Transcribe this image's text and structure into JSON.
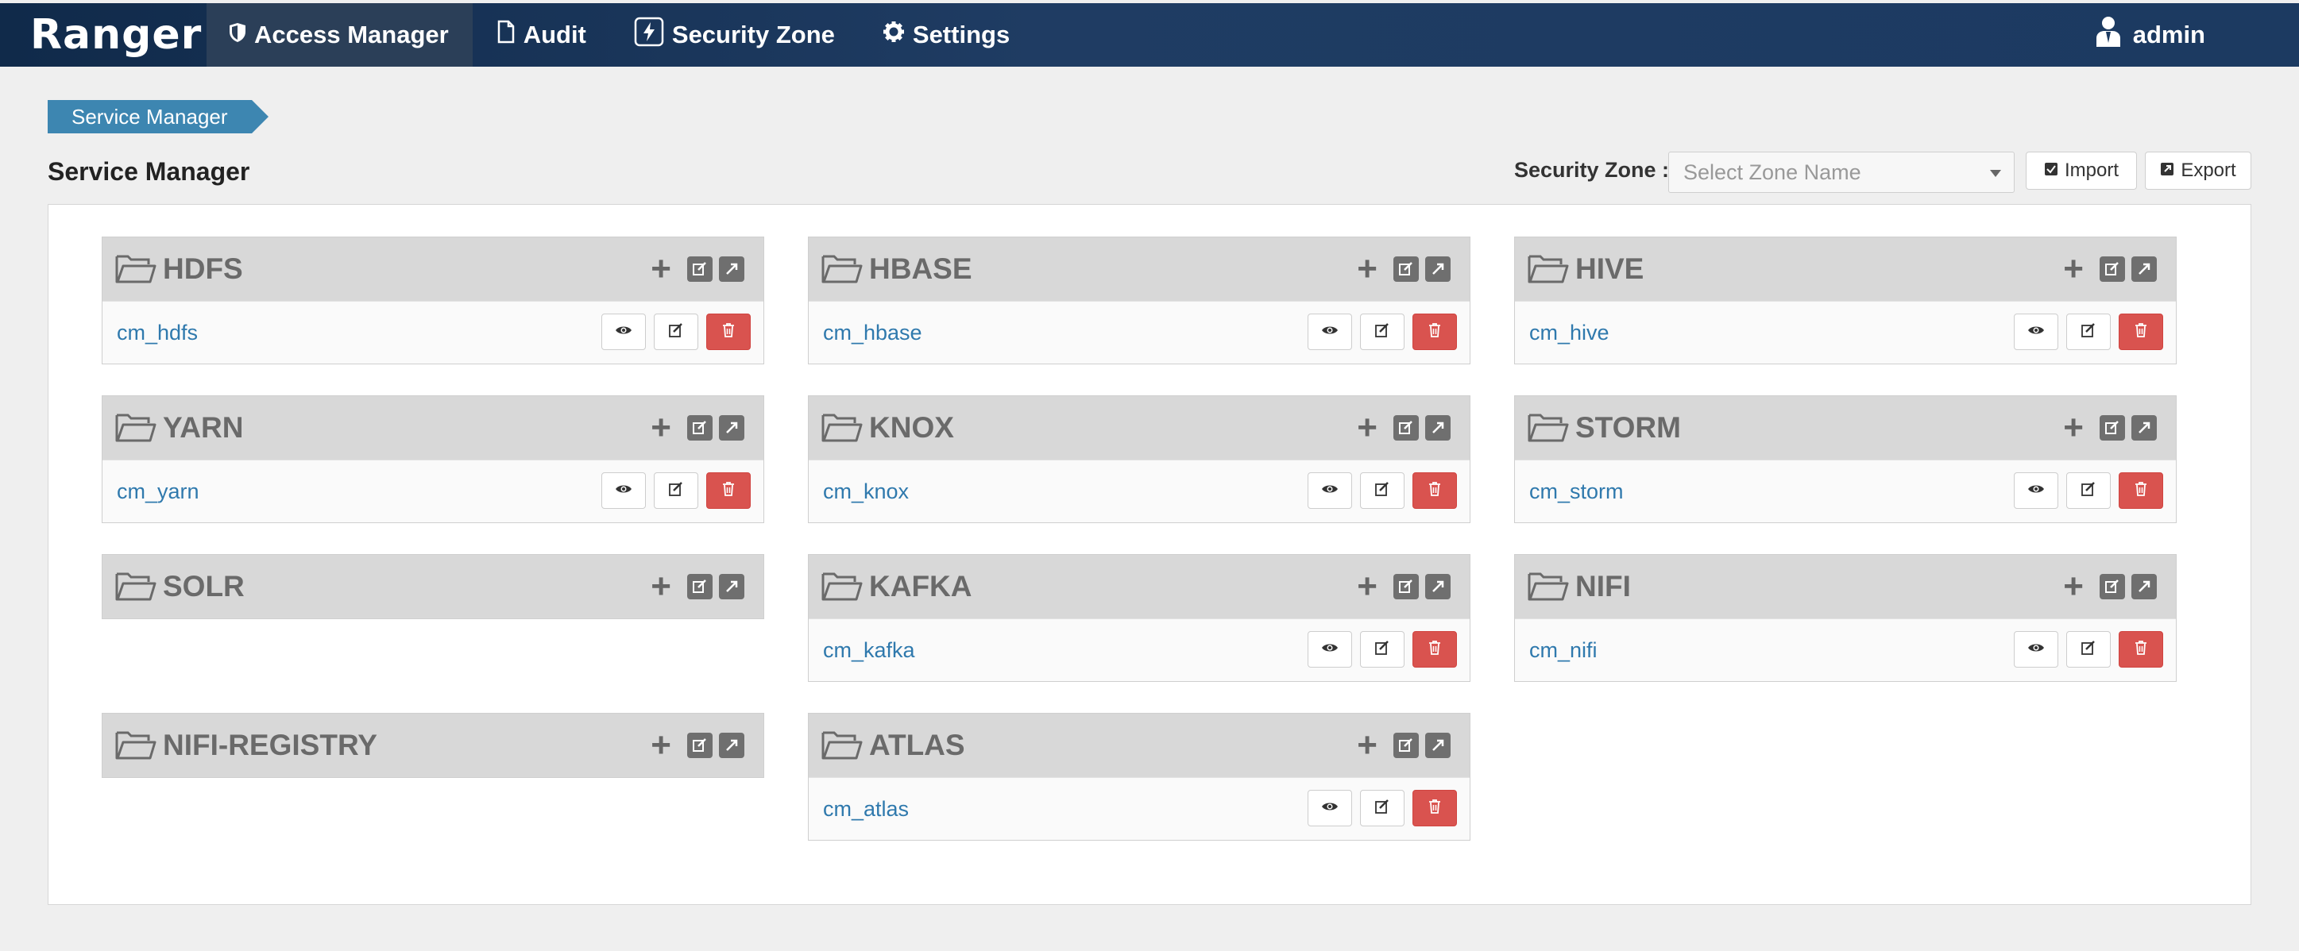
{
  "nav": {
    "brand": "Ranger",
    "items": [
      {
        "label": "Access Manager",
        "icon": "shield-icon"
      },
      {
        "label": "Audit",
        "icon": "file-icon"
      },
      {
        "label": "Security Zone",
        "icon": "lightning-icon"
      },
      {
        "label": "Settings",
        "icon": "gear-icon"
      }
    ],
    "user": "admin"
  },
  "breadcrumb": "Service Manager",
  "page_title": "Service Manager",
  "security_zone": {
    "label": "Security Zone :",
    "placeholder": "Select Zone Name"
  },
  "buttons": {
    "import": "Import",
    "export": "Export"
  },
  "colors": {
    "link": "#2f79ad",
    "delete": "#d9534f",
    "breadcrumb": "#3d86b1",
    "nav": "#1f3c63"
  },
  "services": [
    {
      "name": "HDFS",
      "instances": [
        "cm_hdfs"
      ]
    },
    {
      "name": "HBASE",
      "instances": [
        "cm_hbase"
      ]
    },
    {
      "name": "HIVE",
      "instances": [
        "cm_hive"
      ]
    },
    {
      "name": "YARN",
      "instances": [
        "cm_yarn"
      ]
    },
    {
      "name": "KNOX",
      "instances": [
        "cm_knox"
      ]
    },
    {
      "name": "STORM",
      "instances": [
        "cm_storm"
      ]
    },
    {
      "name": "SOLR",
      "instances": []
    },
    {
      "name": "KAFKA",
      "instances": [
        "cm_kafka"
      ]
    },
    {
      "name": "NIFI",
      "instances": [
        "cm_nifi"
      ]
    },
    {
      "name": "NIFI-REGISTRY",
      "instances": []
    },
    {
      "name": "ATLAS",
      "instances": [
        "cm_atlas"
      ]
    }
  ]
}
